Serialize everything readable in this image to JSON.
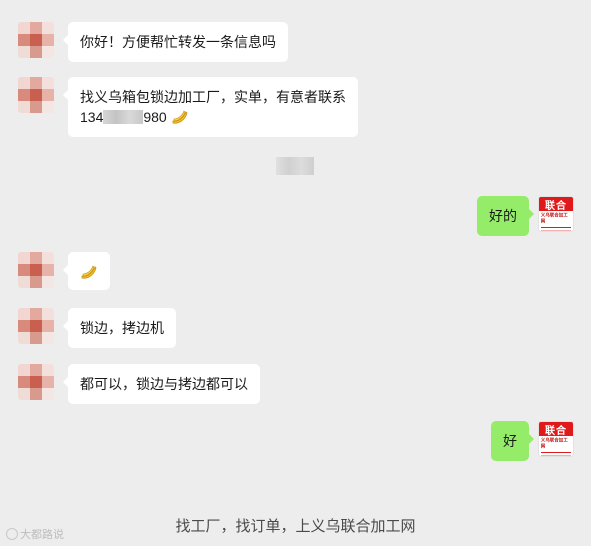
{
  "messages": [
    {
      "from": "other",
      "text": "你好！方便帮忙转发一条信息吗"
    },
    {
      "from": "other",
      "line1": "找义乌箱包锁边加工厂，实单，有意者联系",
      "phone_prefix": "134",
      "phone_suffix": "980"
    },
    {
      "from": "me",
      "text": "好的"
    },
    {
      "from": "other",
      "text": ""
    },
    {
      "from": "other",
      "text": "锁边，拷边机"
    },
    {
      "from": "other",
      "text": "都可以，锁边与拷边都可以"
    },
    {
      "from": "me",
      "text": "好"
    }
  ],
  "my_avatar": {
    "title": "联合",
    "subtitle": "义乌联合加工网"
  },
  "footer": "找工厂，找订单，上义乌联合加工网",
  "watermark": "大都路说",
  "colors": {
    "bg": "#ededed",
    "my_bubble": "#95ec69",
    "their_bubble": "#ffffff",
    "logo_red": "#e01a1a"
  },
  "icons": {
    "banana": "banana-emoji-icon",
    "avatar_mosaic": "blurred-avatar"
  }
}
